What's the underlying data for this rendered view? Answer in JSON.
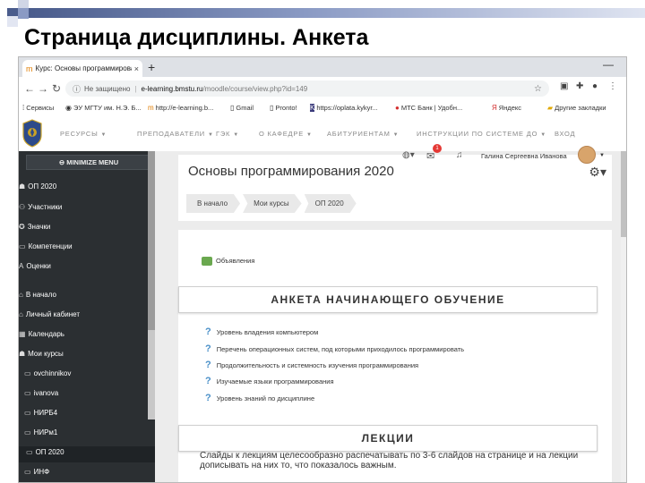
{
  "slide": {
    "title": "Страница дисциплины. Анкета"
  },
  "browser": {
    "tab_title": "Курс: Основы программировани",
    "tab_close": "×",
    "new_tab": "+",
    "window_min": "—",
    "url_security": "Не защищено",
    "url_separator": "|",
    "url_host": "e-learning.bmstu.ru",
    "url_path": "/moodle/course/view.php?id=149",
    "bookmarks": [
      "Сервисы",
      "ЭУ МГТУ им. Н.Э. Б...",
      "http://e-learning.b...",
      "Gmail",
      "Pronto!",
      "https://oplata.kykyr...",
      "МТС Банк | Удобн...",
      "Яндекс",
      "Другие закладки"
    ]
  },
  "moodle_nav": {
    "items": [
      "РЕСУРСЫ",
      "ПРЕПОДАВАТЕЛИ",
      "ГЭК",
      "О КАФЕДРЕ",
      "АБИТУРИЕНТАМ",
      "ИНСТРУКЦИИ ПО СИСТЕМЕ ДО",
      "ВХОД"
    ]
  },
  "sidebar": {
    "minimize": "MINIMIZE MENU",
    "items": [
      {
        "label": "ОП 2020",
        "icon": "graduation-icon"
      },
      {
        "label": "Участники",
        "icon": "users-icon"
      },
      {
        "label": "Значки",
        "icon": "badge-icon"
      },
      {
        "label": "Компетенции",
        "icon": "folder-icon"
      },
      {
        "label": "Оценки",
        "icon": "grades-icon"
      },
      {
        "label": "В начало",
        "icon": "home-icon"
      },
      {
        "label": "Личный кабинет",
        "icon": "dashboard-icon"
      },
      {
        "label": "Календарь",
        "icon": "calendar-icon"
      },
      {
        "label": "Мои курсы",
        "icon": "courses-icon"
      },
      {
        "label": "ovchinnikov",
        "icon": "folder-icon"
      },
      {
        "label": "ivanova",
        "icon": "folder-icon"
      },
      {
        "label": "НИРБ4",
        "icon": "folder-icon"
      },
      {
        "label": "НИРм1",
        "icon": "folder-icon"
      },
      {
        "label": "ОП 2020",
        "icon": "folder-icon"
      },
      {
        "label": "ИНФ",
        "icon": "folder-icon"
      }
    ]
  },
  "user": {
    "name": "Галина Сергеевна Иванова",
    "notifications": "1"
  },
  "course": {
    "title": "Основы программирования 2020",
    "breadcrumbs": [
      "В начало",
      "Мои курсы",
      "ОП 2020"
    ],
    "news": "Объявления",
    "survey_header": "АНКЕТА НАЧИНАЮЩЕГО ОБУЧЕНИЕ",
    "survey_items": [
      "Уровень владения компьютером",
      "Перечень операционных систем, под которыми приходилось программировать",
      "Продолжительность и системность изучения программирования",
      "Изучаемые языки программирования",
      "Уровень знаний по дисциплине"
    ],
    "lectures_header": "ЛЕКЦИИ",
    "lectures_text": "Слайды к лекциям целесообразно распечатывать по 3-6 слайдов на странице и на лекции дописывать на них то, что показалось важным."
  },
  "colors": {
    "sidebar_bg": "#2b2f32",
    "accent": "#4a90c8",
    "badge": "#e53935",
    "deco_blue": "#4a5c8c"
  }
}
